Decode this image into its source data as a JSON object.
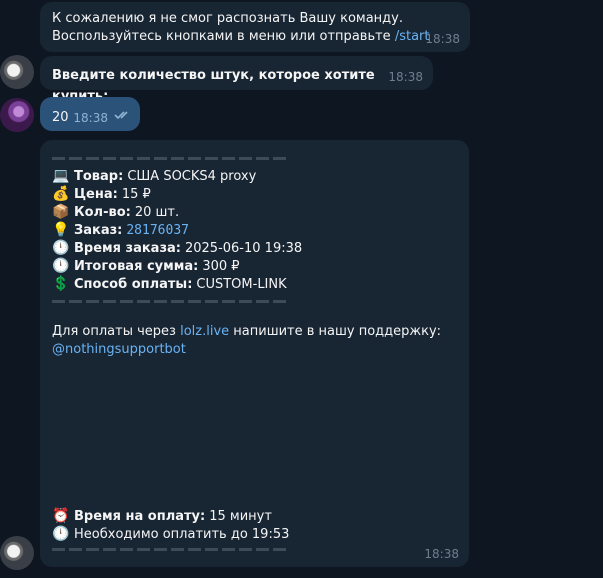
{
  "messages": {
    "m1": {
      "line1": "К сожалению я не смог распознать Вашу команду.",
      "line2_prefix": "Воспользуйтесь кнопками в меню или отправьте ",
      "line2_link": "/start",
      "time": "18:38"
    },
    "m2": {
      "text": "Введите количество штук, которое хотите купить:",
      "time": "18:38"
    },
    "m3": {
      "text": "20",
      "time": "18:38"
    },
    "order": {
      "product_label": "Товар:",
      "product_value": "США SOCKS4 proxy",
      "price_label": "Цена:",
      "price_value": "15 ₽",
      "qty_label": "Кол-во:",
      "qty_value": "20 шт.",
      "order_label": "Заказ:",
      "order_value": "28176037",
      "order_time_label": "Время заказа:",
      "order_time_value": "2025-06-10 19:38",
      "total_label": "Итоговая сумма:",
      "total_value": "300 ₽",
      "payment_label": "Способ оплаты:",
      "payment_value": "CUSTOM-LINK",
      "support_prefix": "Для оплаты через ",
      "support_link": "lolz.live",
      "support_suffix": " напишите в нашу поддержку:",
      "support_bot": "@nothingsupportbot",
      "pay_time_label": "Время на оплату:",
      "pay_time_value": "15 минут",
      "deadline_text": "Необходимо оплатить до 19:53",
      "time": "18:38"
    }
  },
  "icons": {
    "product": "laptop-icon",
    "price": "money-bag-icon",
    "qty": "package-icon",
    "order": "light-bulb-icon",
    "order_time": "clock-icon",
    "total": "clock-icon",
    "payment": "dollar-icon",
    "pay_time": "alarm-clock-icon",
    "deadline": "clock-icon"
  },
  "colors": {
    "background": "#0e1621",
    "incoming_bubble": "#182533",
    "outgoing_bubble": "#2b5278",
    "link": "#6ab3f3"
  }
}
